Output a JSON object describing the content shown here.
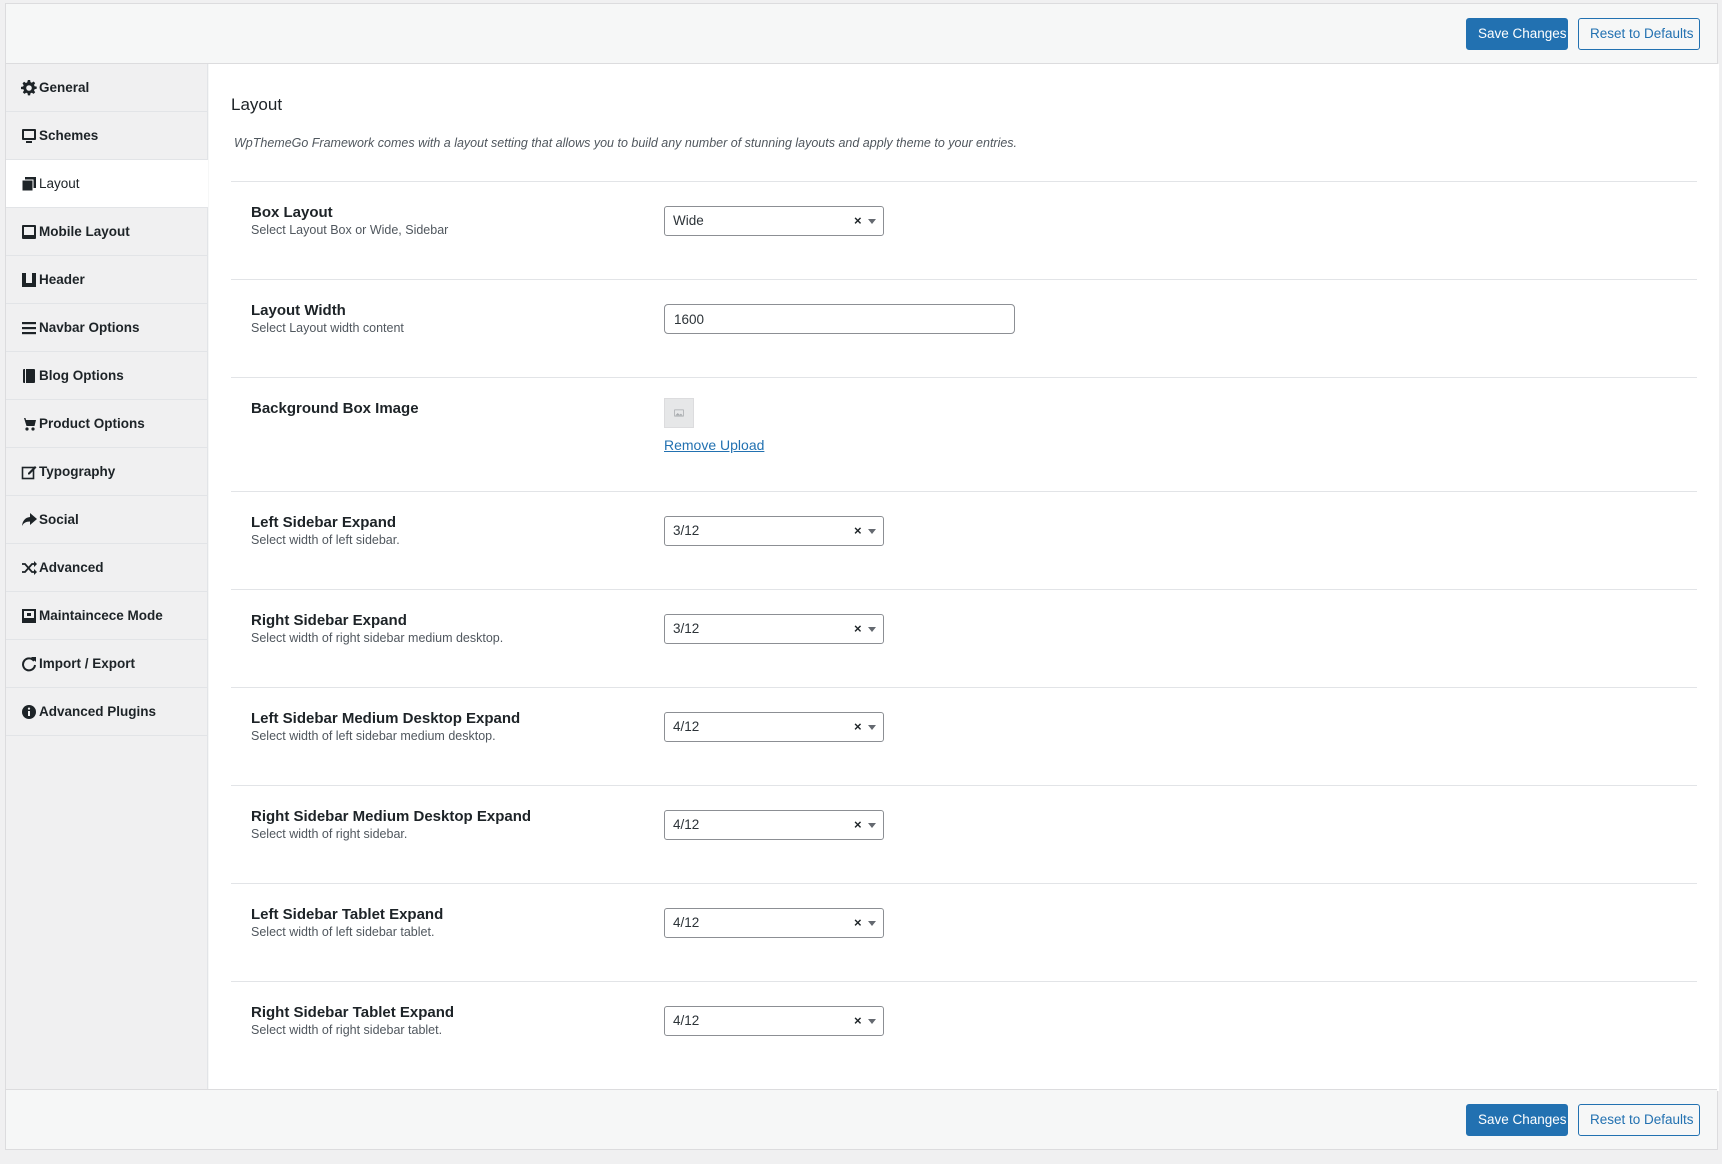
{
  "toolbar": {
    "save_label": "Save Changes",
    "reset_label": "Reset to Defaults"
  },
  "sidebar": {
    "items": [
      {
        "label": "General",
        "icon": "gear-icon"
      },
      {
        "label": "Schemes",
        "icon": "monitor-icon"
      },
      {
        "label": "Layout",
        "icon": "copy-icon",
        "active": true
      },
      {
        "label": "Mobile Layout",
        "icon": "tablet-icon"
      },
      {
        "label": "Header",
        "icon": "header-icon"
      },
      {
        "label": "Navbar Options",
        "icon": "menu-icon"
      },
      {
        "label": "Blog Options",
        "icon": "book-icon"
      },
      {
        "label": "Product Options",
        "icon": "cart-icon"
      },
      {
        "label": "Typography",
        "icon": "edit-icon"
      },
      {
        "label": "Social",
        "icon": "share-icon"
      },
      {
        "label": "Advanced",
        "icon": "shuffle-icon"
      },
      {
        "label": "Maintaincece Mode",
        "icon": "screen-icon"
      },
      {
        "label": "Import / Export",
        "icon": "refresh-icon"
      },
      {
        "label": "Advanced Plugins",
        "icon": "info-icon"
      }
    ]
  },
  "main": {
    "title": "Layout",
    "description": "WpThemeGo Framework comes with a layout setting that allows you to build any number of stunning layouts and apply theme to your entries.",
    "fields": {
      "box_layout": {
        "title": "Box Layout",
        "subtitle": "Select Layout Box or Wide, Sidebar",
        "value": "Wide"
      },
      "layout_width": {
        "title": "Layout Width",
        "subtitle": "Select Layout width content",
        "value": "1600"
      },
      "background_box_image": {
        "title": "Background Box Image",
        "remove_label": "Remove Upload"
      },
      "left_sidebar_expand": {
        "title": "Left Sidebar Expand",
        "subtitle": "Select width of left sidebar.",
        "value": "3/12"
      },
      "right_sidebar_expand": {
        "title": "Right Sidebar Expand",
        "subtitle": "Select width of right sidebar medium desktop.",
        "value": "3/12"
      },
      "left_sidebar_medium": {
        "title": "Left Sidebar Medium Desktop Expand",
        "subtitle": "Select width of left sidebar medium desktop.",
        "value": "4/12"
      },
      "right_sidebar_medium": {
        "title": "Right Sidebar Medium Desktop Expand",
        "subtitle": "Select width of right sidebar.",
        "value": "4/12"
      },
      "left_sidebar_tablet": {
        "title": "Left Sidebar Tablet Expand",
        "subtitle": "Select width of left sidebar tablet.",
        "value": "4/12"
      },
      "right_sidebar_tablet": {
        "title": "Right Sidebar Tablet Expand",
        "subtitle": "Select width of right sidebar tablet.",
        "value": "4/12"
      }
    },
    "clear_glyph": "×"
  },
  "colors": {
    "primary": "#2271b1",
    "sidebar_bg": "#f0f0f1",
    "content_bg": "#ffffff"
  }
}
